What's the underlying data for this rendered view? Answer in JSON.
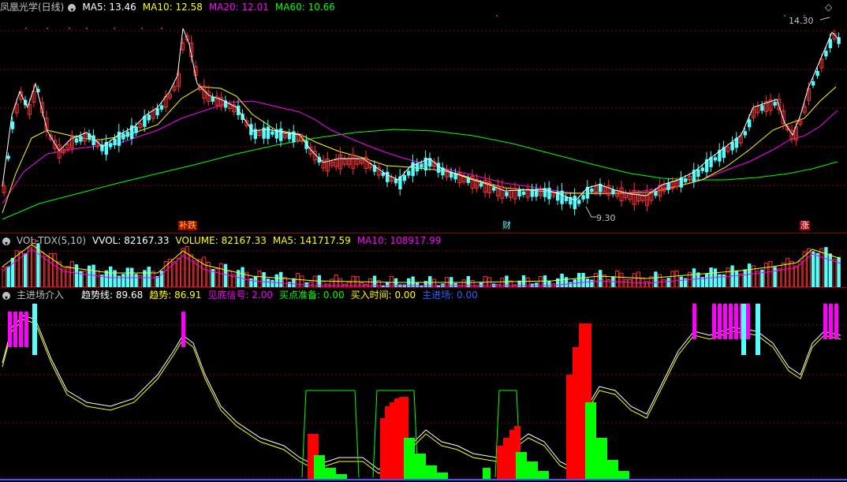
{
  "colors": {
    "up": "#ff3232",
    "down": "#54ffff",
    "ma5": "#ffffff",
    "ma10": "#ffff00",
    "ma20": "#ff00ff",
    "ma60": "#00ff00",
    "grid": "#8b0000",
    "green": "#00ff00",
    "red": "#ff0000",
    "blue": "#3060ff"
  },
  "main": {
    "title": "凤凰光学(日线)",
    "legend": [
      {
        "label": "MA5: 13.46",
        "color": "#ffffff"
      },
      {
        "label": "MA10: 12.58",
        "color": "#ffff00"
      },
      {
        "label": "MA20: 12.01",
        "color": "#ff00ff"
      },
      {
        "label": "MA60: 10.66",
        "color": "#00ff00"
      }
    ],
    "high_label": "14.30",
    "low_label": "9.30",
    "markers": [
      {
        "text": "补跌",
        "bg": "#a00000",
        "color": "#ffd800"
      },
      {
        "text": "财",
        "bg": "#000",
        "color": "#54ffff"
      },
      {
        "text": "涨",
        "bg": "#a00000",
        "color": "#ffffff"
      }
    ]
  },
  "volume": {
    "title": "VOL-TDX(5,10)",
    "legend": [
      {
        "label": "VVOL: 82167.33",
        "color": "#ffffff"
      },
      {
        "label": "VOLUME: 82167.33",
        "color": "#ffff00"
      },
      {
        "label": "MA5: 141717.59",
        "color": "#ffff00"
      },
      {
        "label": "MA10: 108917.99",
        "color": "#ff00ff"
      }
    ]
  },
  "indicator": {
    "title": "主进场介入",
    "legend": [
      {
        "label": "趋势线: 89.68",
        "color": "#ffffff"
      },
      {
        "label": "趋势: 86.91",
        "color": "#ffff00"
      },
      {
        "label": "见底信号: 2.00",
        "color": "#ff00ff"
      },
      {
        "label": "买点准备: 0.00",
        "color": "#00ff00"
      },
      {
        "label": "买入时间: 0.00",
        "color": "#ffff00"
      },
      {
        "label": "主进场: 0.00",
        "color": "#3060ff"
      }
    ]
  }
}
